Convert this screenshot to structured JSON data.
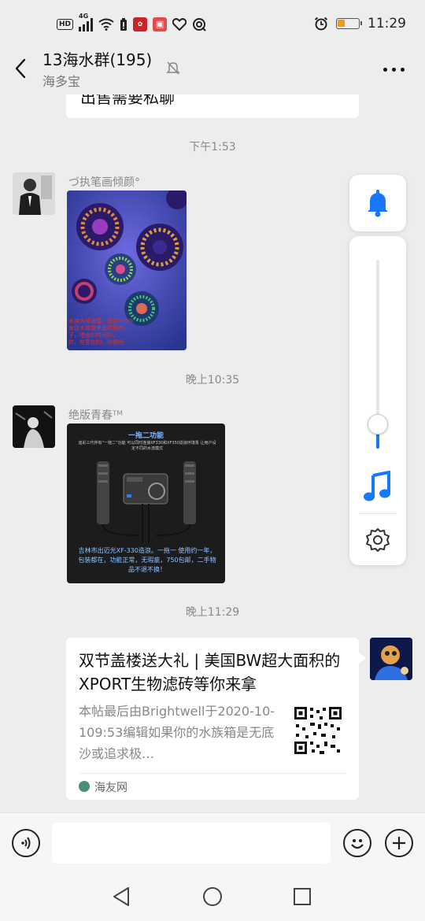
{
  "status_bar": {
    "network_badge": "HD",
    "network_type": "4G",
    "time": "11:29",
    "battery_color": "#f29b0c",
    "icons": [
      "hd-icon",
      "signal-icon",
      "wifi-icon",
      "battery-saver-icon",
      "app-notification-icon",
      "app-notification-icon",
      "heart-icon",
      "hotspot-icon",
      "alarm-icon",
      "battery-icon"
    ]
  },
  "header": {
    "title": "13海水群(195)",
    "subtitle": "海多宝",
    "icons": [
      "back-arrow-icon",
      "mute-bell-icon",
      "more-dots-icon"
    ]
  },
  "messages": {
    "previous_text": "出售需要私聊",
    "time1": "下午1:53",
    "msg1": {
      "sender": "づ执笔画倾颜°",
      "image_caption": "水族大师海藻，测评100%\n发现水族馆里面的东西，\n子，喂食的时间的，\n你，在意你的，你看吧"
    },
    "time2": "晚上10:35",
    "msg2": {
      "sender": "绝版青春ᵀᴹ",
      "image_heading": "一拖二功能",
      "image_subtext": "迪彩三代伴有“一拖二”功能  可以同时连接XF330和XF350造浪环境泵\n让用户设定不同的水流模式",
      "image_caption": "吉林市出迈光XF-330造浪。一拖一 使用约一年，包装都在，功能正常，无瑕疵，750包邮，二手物品不退不换！"
    },
    "time3": "晚上11:29",
    "link_card": {
      "title": "双节盖楼送大礼 | 美国BW超大面积的XPORT生物滤砖等你来拿",
      "description": "本帖最后由Brightwell于2020-10-109:53编辑如果你的水族箱是无底沙或追求极…",
      "source": "海友网"
    }
  },
  "volume_panel": {
    "level_percent": 13,
    "accent_color": "#1677ff",
    "icons": [
      "bell-icon",
      "music-note-icon",
      "settings-gear-icon"
    ]
  },
  "input_bar": {
    "placeholder": "",
    "icons": [
      "voice-icon",
      "emoji-icon",
      "plus-icon"
    ]
  },
  "nav_bar": {
    "icons": [
      "nav-back-icon",
      "nav-home-icon",
      "nav-recents-icon"
    ]
  }
}
